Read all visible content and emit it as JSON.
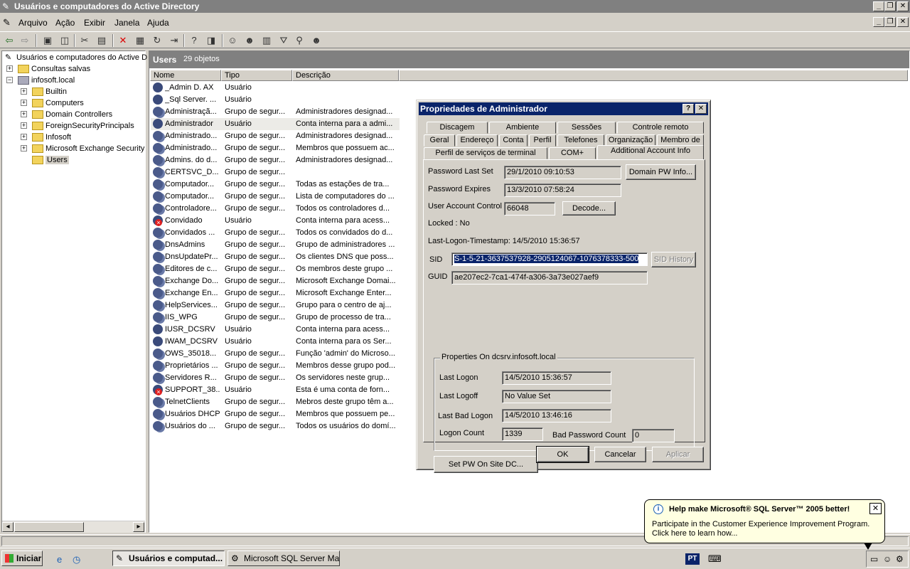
{
  "window": {
    "title": "Usuários e computadores do Active Directory"
  },
  "menu": [
    "Arquivo",
    "Ação",
    "Exibir",
    "Janela",
    "Ajuda"
  ],
  "tree": {
    "root": "Usuários e computadores do Active D",
    "saved": "Consultas salvas",
    "domain": "infosoft.local",
    "children": [
      "Builtin",
      "Computers",
      "Domain Controllers",
      "ForeignSecurityPrincipals",
      "Infosoft",
      "Microsoft Exchange Security",
      "Users"
    ]
  },
  "right": {
    "header_title": "Users",
    "header_count": "29 objetos",
    "columns": [
      "Nome",
      "Tipo",
      "Descrição"
    ],
    "rows": [
      {
        "name": "_Admin D. AX",
        "type": "Usuário",
        "desc": "",
        "icon": "user"
      },
      {
        "name": "_Sql Server. ...",
        "type": "Usuário",
        "desc": "",
        "icon": "user"
      },
      {
        "name": "Administraçã...",
        "type": "Grupo de segur...",
        "desc": "Administradores designad...",
        "icon": "group"
      },
      {
        "name": "Administrador",
        "type": "Usuário",
        "desc": "Conta interna para a admi...",
        "icon": "user"
      },
      {
        "name": "Administrado...",
        "type": "Grupo de segur...",
        "desc": "Administradores designad...",
        "icon": "group"
      },
      {
        "name": "Administrado...",
        "type": "Grupo de segur...",
        "desc": "Membros que possuem ac...",
        "icon": "group"
      },
      {
        "name": "Admins. do d...",
        "type": "Grupo de segur...",
        "desc": "Administradores designad...",
        "icon": "group"
      },
      {
        "name": "CERTSVC_D...",
        "type": "Grupo de segur...",
        "desc": "",
        "icon": "group"
      },
      {
        "name": "Computador...",
        "type": "Grupo de segur...",
        "desc": "Todas as estações de tra...",
        "icon": "group"
      },
      {
        "name": "Computador...",
        "type": "Grupo de segur...",
        "desc": "Lista de computadores do ...",
        "icon": "group"
      },
      {
        "name": "Controladore...",
        "type": "Grupo de segur...",
        "desc": "Todos os controladores d...",
        "icon": "group"
      },
      {
        "name": "Convidado",
        "type": "Usuário",
        "desc": "Conta interna para acess...",
        "icon": "disabled"
      },
      {
        "name": "Convidados ...",
        "type": "Grupo de segur...",
        "desc": "Todos os convidados do d...",
        "icon": "group"
      },
      {
        "name": "DnsAdmins",
        "type": "Grupo de segur...",
        "desc": "Grupo de administradores ...",
        "icon": "group"
      },
      {
        "name": "DnsUpdatePr...",
        "type": "Grupo de segur...",
        "desc": "Os clientes DNS que poss...",
        "icon": "group"
      },
      {
        "name": "Editores de c...",
        "type": "Grupo de segur...",
        "desc": "Os membros deste grupo ...",
        "icon": "group"
      },
      {
        "name": "Exchange Do...",
        "type": "Grupo de segur...",
        "desc": "Microsoft Exchange Domai...",
        "icon": "group"
      },
      {
        "name": "Exchange En...",
        "type": "Grupo de segur...",
        "desc": "Microsoft Exchange Enter...",
        "icon": "group"
      },
      {
        "name": "HelpServices...",
        "type": "Grupo de segur...",
        "desc": "Grupo para o centro de aj...",
        "icon": "group"
      },
      {
        "name": "IIS_WPG",
        "type": "Grupo de segur...",
        "desc": "Grupo de processo de tra...",
        "icon": "group"
      },
      {
        "name": "IUSR_DCSRV",
        "type": "Usuário",
        "desc": "Conta interna para acess...",
        "icon": "user"
      },
      {
        "name": "IWAM_DCSRV",
        "type": "Usuário",
        "desc": "Conta interna para os Ser...",
        "icon": "user"
      },
      {
        "name": "OWS_35018...",
        "type": "Grupo de segur...",
        "desc": "Função 'admin' do Microso...",
        "icon": "group"
      },
      {
        "name": "Proprietários ...",
        "type": "Grupo de segur...",
        "desc": "Membros desse grupo pod...",
        "icon": "group"
      },
      {
        "name": "Servidores R...",
        "type": "Grupo de segur...",
        "desc": "Os servidores neste grup...",
        "icon": "group"
      },
      {
        "name": "SUPPORT_38...",
        "type": "Usuário",
        "desc": "Esta é uma conta de forn...",
        "icon": "disabled"
      },
      {
        "name": "TelnetClients",
        "type": "Grupo de segur...",
        "desc": "Mebros deste grupo têm a...",
        "icon": "group"
      },
      {
        "name": "Usuários DHCP",
        "type": "Grupo de segur...",
        "desc": "Membros que possuem pe...",
        "icon": "group"
      },
      {
        "name": "Usuários do ...",
        "type": "Grupo de segur...",
        "desc": "Todos os usuários do domí...",
        "icon": "group"
      }
    ]
  },
  "dialog": {
    "title": "Propriedades de Administrador",
    "help_glyph": "?",
    "close_glyph": "✕",
    "tabs_row1": [
      "Discagem",
      "Ambiente",
      "Sessões",
      "Controle remoto"
    ],
    "tabs_row2": [
      "Geral",
      "Endereço",
      "Conta",
      "Perfil",
      "Telefones",
      "Organização",
      "Membro de"
    ],
    "tabs_row3": [
      "Perfil de serviços de terminal",
      "COM+",
      "Additional Account Info"
    ],
    "password_last_set_label": "Password Last Set",
    "password_last_set": "29/1/2010 09:10:53",
    "domain_pw_info_btn": "Domain PW Info...",
    "password_expires_label": "Password Expires",
    "password_expires": "13/3/2010 07:58:24",
    "uac_label": "User Account Control",
    "uac": "66048",
    "decode_btn": "Decode...",
    "locked": "Locked : No",
    "last_logon_ts": "Last-Logon-Timestamp: 14/5/2010 15:36:57",
    "sid_label": "SID",
    "sid": "S-1-5-21-3637537928-2905124067-1076378333-500",
    "sid_history_btn": "SID History",
    "guid_label": "GUID",
    "guid": "ae207ec2-7ca1-474f-a306-3a73e027aef9",
    "group_title": "Properties On dcsrv.infosoft.local",
    "last_logon_label": "Last Logon",
    "last_logon": "14/5/2010 15:36:57",
    "last_logoff_label": "Last Logoff",
    "last_logoff": "No Value Set",
    "last_bad_logon_label": "Last Bad Logon",
    "last_bad_logon": "14/5/2010 13:46:16",
    "logon_count_label": "Logon Count",
    "logon_count": "1339",
    "bad_pw_count_label": "Bad Password Count",
    "bad_pw_count": "0",
    "set_pw_btn": "Set PW On Site DC...",
    "ok": "OK",
    "cancel": "Cancelar",
    "apply": "Aplicar"
  },
  "balloon": {
    "title": "Help make Microsoft® SQL Server™ 2005 better!",
    "text1": "Participate in the Customer Experience Improvement Program.",
    "text2": "Click here to learn how..."
  },
  "taskbar": {
    "start": "Iniciar",
    "tasks": [
      "Usuários e computad...",
      "Microsoft SQL Server Ma..."
    ],
    "lang": "PT"
  }
}
